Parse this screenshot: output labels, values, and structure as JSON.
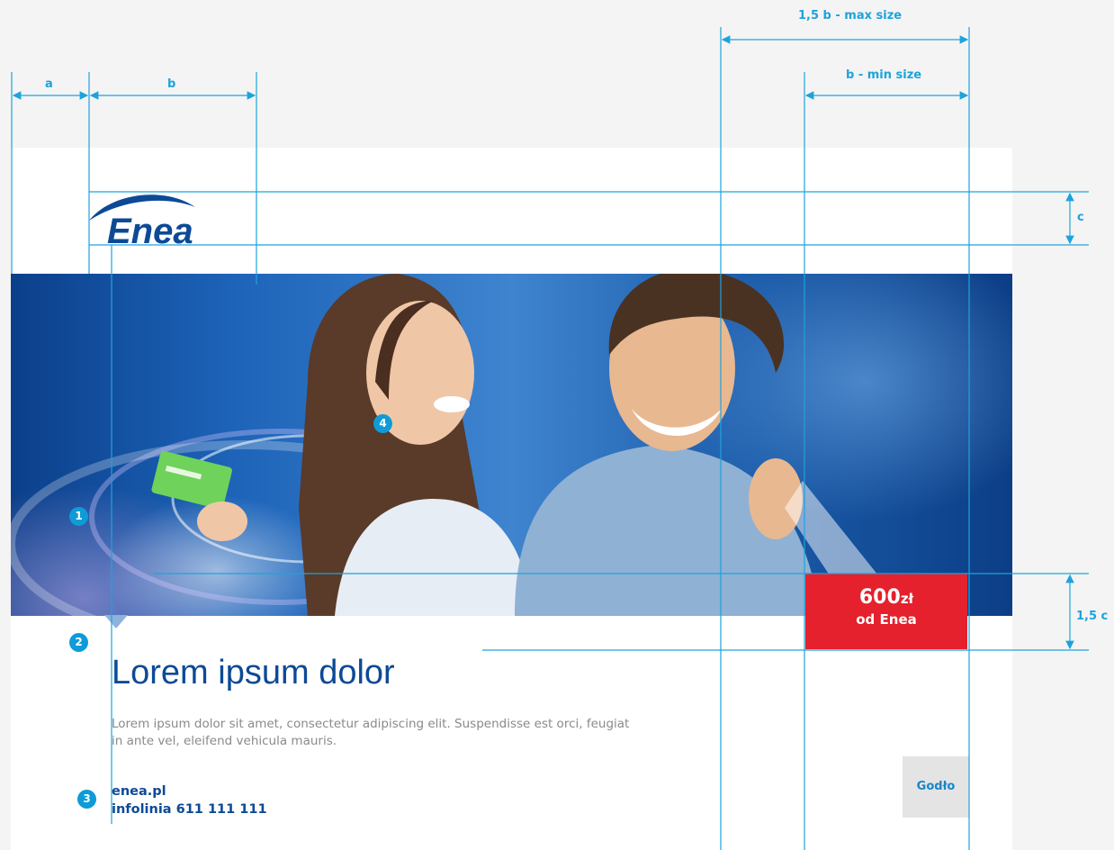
{
  "brand": {
    "logo_text": "Enea",
    "accent_color": "#0d4a96",
    "guide_color": "#1da3dc",
    "offer_color": "#e4212c"
  },
  "hero": {
    "image_description_icon": "hero-photo-couple-shopping"
  },
  "badges": [
    "1",
    "2",
    "3",
    "4"
  ],
  "headline": "Lorem ipsum dolor",
  "body_text": "Lorem ipsum dolor sit amet, consectetur adipiscing elit. Suspendisse est orci, feugiat in ante vel, eleifend vehicula mauris.",
  "contact": {
    "website": "enea.pl",
    "hotline": "infolinia 611 111 111"
  },
  "offer": {
    "amount": "600",
    "currency": "zł",
    "subtitle": "od Enea"
  },
  "emblem": {
    "label": "Godło"
  },
  "dimensions": {
    "a": "a",
    "b": "b",
    "b_max": "1,5 b - max size",
    "b_min": "b - min size",
    "c": "c",
    "c_15": "1,5 c"
  }
}
